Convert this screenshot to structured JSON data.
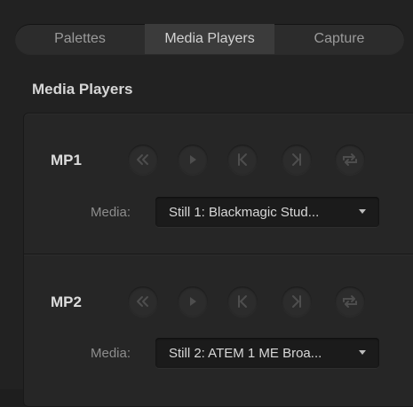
{
  "tabs": [
    {
      "label": "Palettes",
      "active": false
    },
    {
      "label": "Media Players",
      "active": true
    },
    {
      "label": "Capture",
      "active": false
    }
  ],
  "section_title": "Media Players",
  "players": [
    {
      "label": "MP1",
      "media_label": "Media:",
      "media_value": "Still 1: Blackmagic Stud...",
      "controls": [
        "rewind-icon",
        "play-icon",
        "previous-frame-icon",
        "next-frame-icon",
        "loop-icon"
      ]
    },
    {
      "label": "MP2",
      "media_label": "Media:",
      "media_value": "Still 2: ATEM 1 ME Broa...",
      "controls": [
        "rewind-icon",
        "play-icon",
        "previous-frame-icon",
        "next-frame-icon",
        "loop-icon"
      ]
    }
  ],
  "colors": {
    "background": "#222222",
    "panel": "#262626",
    "control_button": "#2c2c2c",
    "icon_dim": "#4e4e4e",
    "text_primary": "#dcdcdc",
    "text_muted": "#8d8d8d"
  }
}
